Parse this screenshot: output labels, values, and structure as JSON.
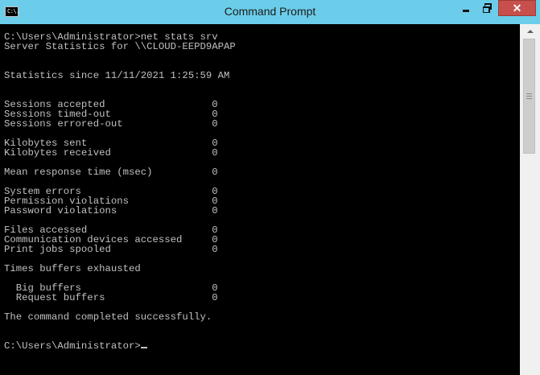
{
  "window": {
    "title": "Command Prompt",
    "icon_label": "C:\\.",
    "controls": {
      "minimize_icon": "minimize-icon",
      "maximize_icon": "restore-icon",
      "close_glyph": "✕"
    }
  },
  "console": {
    "lines": [
      "C:\\Users\\Administrator>net stats srv",
      "Server Statistics for \\\\CLOUD-EEPD9APAP",
      "",
      "",
      "Statistics since 11/11/2021 1:25:59 AM",
      "",
      "",
      "Sessions accepted                  0",
      "Sessions timed-out                 0",
      "Sessions errored-out               0",
      "",
      "Kilobytes sent                     0",
      "Kilobytes received                 0",
      "",
      "Mean response time (msec)          0",
      "",
      "System errors                      0",
      "Permission violations              0",
      "Password violations                0",
      "",
      "Files accessed                     0",
      "Communication devices accessed     0",
      "Print jobs spooled                 0",
      "",
      "Times buffers exhausted",
      "",
      "  Big buffers                      0",
      "  Request buffers                  0",
      "",
      "The command completed successfully.",
      "",
      "",
      "C:\\Users\\Administrator>"
    ]
  },
  "colors": {
    "titlebar": "#6ccdea",
    "close_button": "#c7504c",
    "console_bg": "#000000",
    "console_fg": "#c0c0c0"
  }
}
